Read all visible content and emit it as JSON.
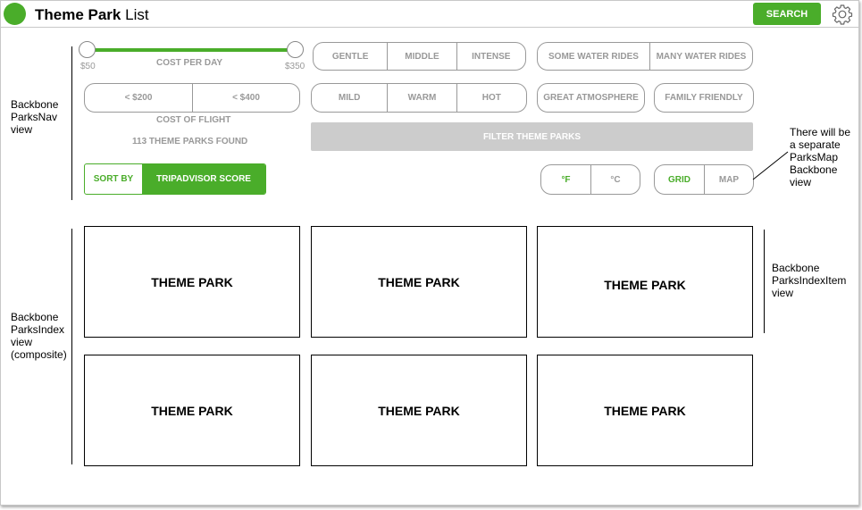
{
  "header": {
    "title_bold": "Theme Park",
    "title_rest": " List",
    "search_label": "SEARCH"
  },
  "nav": {
    "cost_per_day": {
      "label": "COST PER DAY",
      "min_label": "$50",
      "max_label": "$350",
      "min": 50,
      "max": 350,
      "selected": [
        50,
        350
      ]
    },
    "intensity": [
      "GENTLE",
      "MIDDLE",
      "INTENSE"
    ],
    "water": [
      "SOME WATER RIDES",
      "MANY WATER RIDES"
    ],
    "cost_of_flight": {
      "options": [
        "< $200",
        "< $400"
      ],
      "label": "COST OF FLIGHT"
    },
    "climate": [
      "MILD",
      "WARM",
      "HOT"
    ],
    "atmosphere": "GREAT ATMOSPHERE",
    "family": "FAMILY FRIENDLY",
    "found": "113 THEME PARKS FOUND",
    "filter_label": "FILTER THEME PARKS",
    "sort": {
      "label": "SORT BY",
      "value": "TRIPADVISOR SCORE"
    },
    "units": [
      "°F",
      "°C"
    ],
    "view": [
      "GRID",
      "MAP"
    ]
  },
  "cards": [
    "THEME PARK",
    "THEME PARK",
    "THEME PARK",
    "THEME PARK",
    "THEME PARK",
    "THEME PARK"
  ],
  "annotations": {
    "parks_nav": [
      "Backbone",
      "ParksNav",
      "view"
    ],
    "parks_map": [
      "There will be",
      "a separate",
      "ParksMap",
      "Backbone",
      "view"
    ],
    "parks_index": [
      "Backbone",
      "ParksIndex",
      "view",
      "(composite)"
    ],
    "parks_index_item": [
      "Backbone",
      "ParksIndexItem",
      "view"
    ]
  },
  "colors": {
    "accent": "#4aad2a",
    "muted": "#999999",
    "filter_bg": "#cccccc"
  }
}
